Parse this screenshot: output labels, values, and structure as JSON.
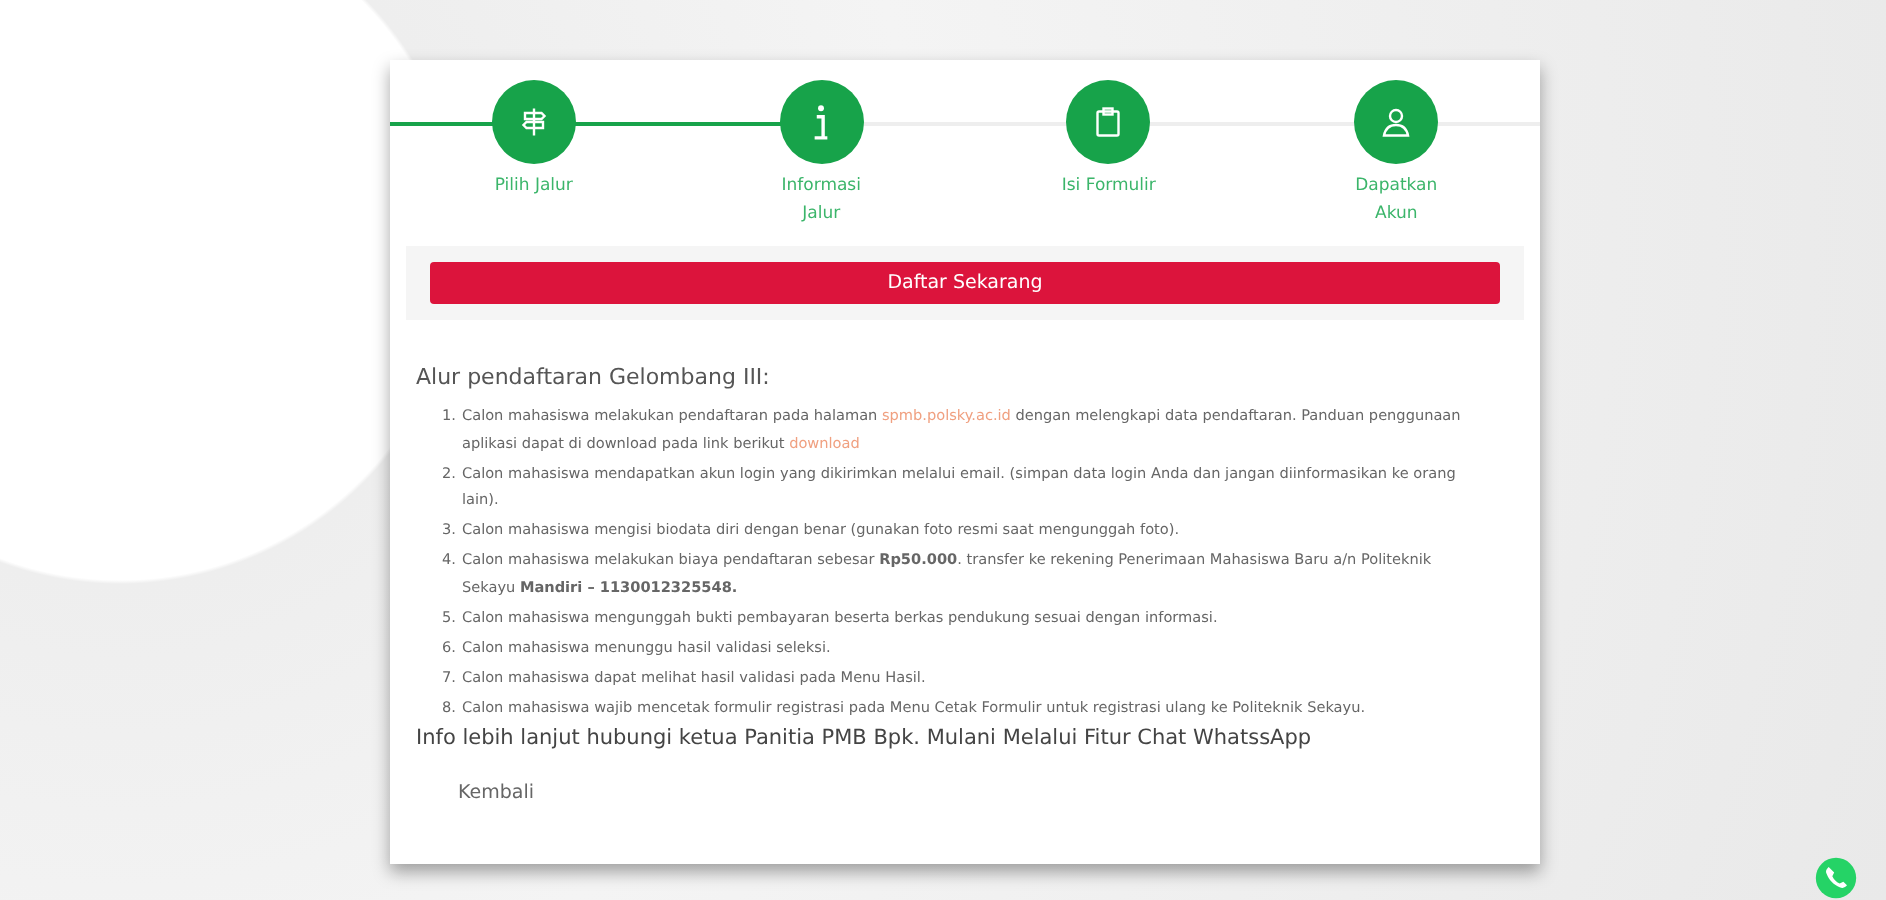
{
  "steps": [
    {
      "label": "Pilih Jalur",
      "reached": true
    },
    {
      "label": "Informasi Jalur",
      "reached": true
    },
    {
      "label": "Isi Formulir",
      "reached": false
    },
    {
      "label": "Dapatkan Akun",
      "reached": false
    }
  ],
  "register_button": "Daftar Sekarang",
  "heading": "Alur pendaftaran Gelombang III:",
  "items": [
    {
      "number": "1.",
      "parts": [
        {
          "kind": "text",
          "text": "Calon mahasiswa melakukan pendaftaran pada halaman "
        },
        {
          "kind": "link",
          "text": "spmb.polsky.ac.id"
        },
        {
          "kind": "text",
          "text": " dengan melengkapi data pendaftaran. Panduan penggunaan aplikasi dapat di download pada link berikut "
        },
        {
          "kind": "link",
          "text": "download"
        }
      ]
    },
    {
      "number": "2.",
      "parts": [
        {
          "kind": "text",
          "text": "Calon mahasiswa mendapatkan akun login yang dikirimkan melalui email. (simpan data login Anda dan jangan diinformasikan ke orang lain)."
        }
      ]
    },
    {
      "number": "3.",
      "parts": [
        {
          "kind": "text",
          "text": "Calon mahasiswa mengisi biodata diri dengan benar (gunakan foto resmi saat mengunggah foto)."
        }
      ]
    },
    {
      "number": "4.",
      "parts": [
        {
          "kind": "text",
          "text": "Calon mahasiswa melakukan biaya pendaftaran sebesar **Rp50.000**. transfer ke rekening Penerimaan Mahasiswa Baru a/n Politeknik Sekayu **Mandiri – 1130012325548.**"
        }
      ]
    },
    {
      "number": "5.",
      "parts": [
        {
          "kind": "text",
          "text": "Calon mahasiswa mengunggah bukti pembayaran beserta berkas pendukung sesuai dengan informasi."
        }
      ]
    },
    {
      "number": "6.",
      "parts": [
        {
          "kind": "text",
          "text": "Calon mahasiswa menunggu hasil validasi seleksi."
        }
      ]
    },
    {
      "number": "7.",
      "parts": [
        {
          "kind": "text",
          "text": "Calon mahasiswa dapat melihat hasil validasi pada Menu Hasil."
        }
      ]
    },
    {
      "number": "8.",
      "parts": [
        {
          "kind": "text",
          "text": "Calon mahasiswa wajib mencetak formulir registrasi pada Menu Cetak Formulir untuk registrasi ulang ke Politeknik Sekayu."
        }
      ]
    }
  ],
  "info": "Info lebih lanjut hubungi ketua Panitia PMB Bpk. Mulani Melalui Fitur Chat WhatssApp",
  "back_link": "Kembali"
}
